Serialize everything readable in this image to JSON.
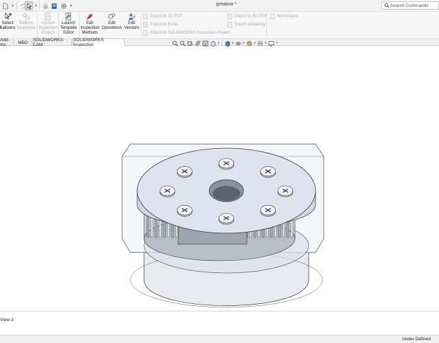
{
  "window": {
    "title": "greabox *",
    "search_placeholder": "Search Commands"
  },
  "ribbon": {
    "buttons": [
      {
        "label": "Select\nBalloons",
        "enabled": true,
        "icon": "select-balloons-icon"
      },
      {
        "label": "Balloon\nSequence",
        "enabled": false,
        "icon": "balloon-sequence-icon"
      },
      {
        "label": "Update\nInspection\nProject",
        "enabled": false,
        "icon": "update-project-icon"
      },
      {
        "label": "Launch\nTemplate\nEditor",
        "enabled": true,
        "icon": "template-editor-icon"
      },
      {
        "label": "Edit\nInspection\nMethods",
        "enabled": true,
        "icon": "edit-methods-icon"
      },
      {
        "label": "Edit\nOperations",
        "enabled": true,
        "icon": "edit-operations-icon"
      },
      {
        "label": "Edit\nVendors",
        "enabled": true,
        "icon": "edit-vendors-icon"
      }
    ],
    "export_buttons": [
      {
        "label": "Export to 2D PDF",
        "enabled": false,
        "icon": "pdf-2d-icon"
      },
      {
        "label": "Export to Excel",
        "enabled": false,
        "icon": "excel-icon"
      },
      {
        "label": "Export to SOLIDWORKS Inspection Project",
        "enabled": false,
        "icon": "inspection-project-icon"
      },
      {
        "label": "Export to 3D PDF",
        "enabled": false,
        "icon": "pdf-3d-icon"
      },
      {
        "label": "Export eDrawing",
        "enabled": false,
        "icon": "edrawing-icon"
      },
      {
        "label": "Net-Inspect",
        "enabled": false,
        "icon": "net-inspect-icon"
      }
    ]
  },
  "tabs": [
    {
      "label": "Add-Ins",
      "active": false
    },
    {
      "label": "MBD",
      "active": false
    },
    {
      "label": "SOLIDWORKS CAM",
      "active": false
    },
    {
      "label": "SOLIDWORKS Inspection",
      "active": true
    }
  ],
  "bottom": {
    "view_tab": "View-3"
  },
  "status": {
    "text": "Under Defined"
  },
  "colors": {
    "ui_background": "#f7f7f7",
    "viewport_background": "#ffffff",
    "model_lid": "#dfe3f0",
    "model_housing": "#eceef4",
    "model_edge": "#333333",
    "active_tab": "#ffffff"
  }
}
